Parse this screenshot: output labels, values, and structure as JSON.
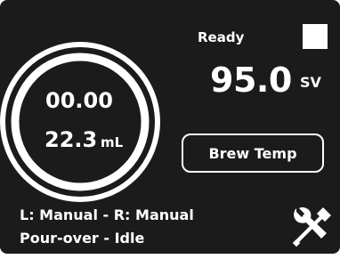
{
  "gauge": {
    "timer": "00.00",
    "volume": "22.3",
    "volume_unit": "mL"
  },
  "status": {
    "label": "Ready"
  },
  "setpoint": {
    "value": "95.0",
    "unit": "SV"
  },
  "buttons": {
    "brew_temp": "Brew Temp"
  },
  "mode": {
    "line1": "L: Manual - R: Manual",
    "line2": "Pour-over - Idle"
  },
  "icons": {
    "settings": "tools-icon"
  },
  "colors": {
    "background": "#1b1b1b",
    "foreground": "#ffffff"
  }
}
